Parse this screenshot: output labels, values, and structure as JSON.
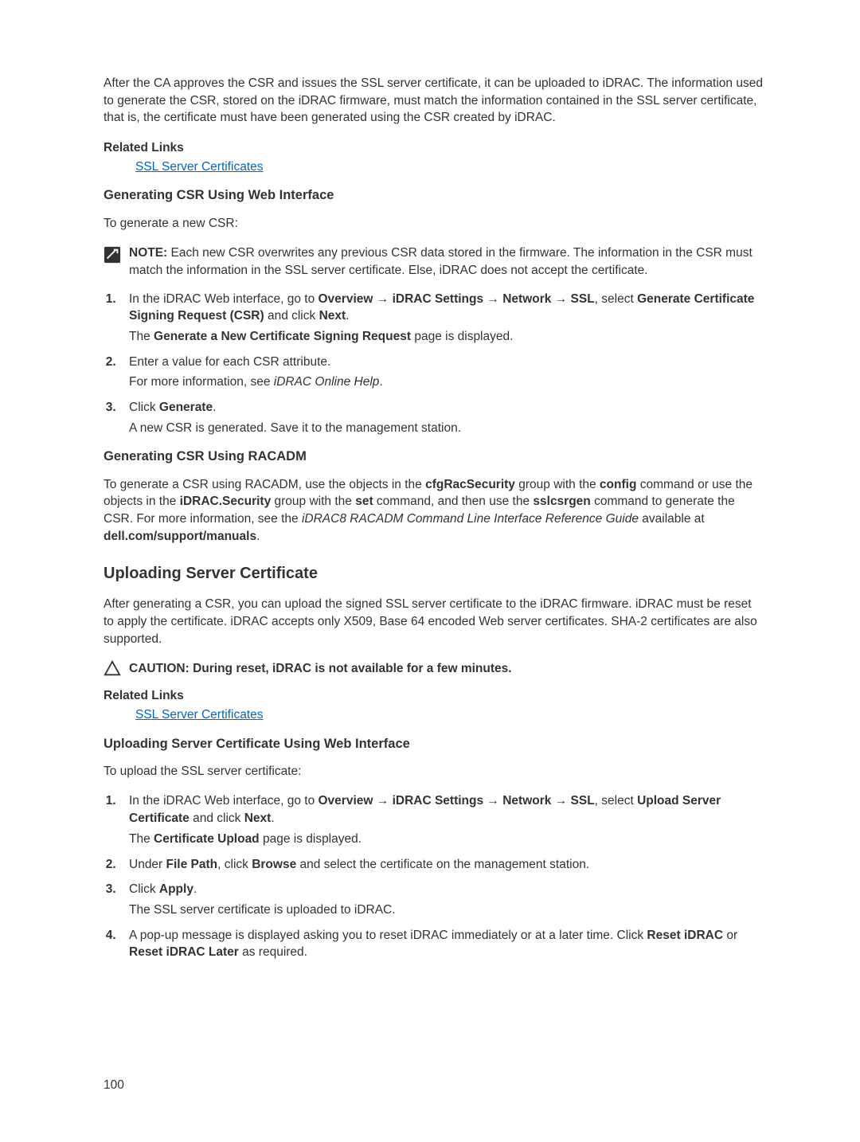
{
  "intro": "After the CA approves the CSR and issues the SSL server certificate, it can be uploaded to iDRAC. The information used to generate the CSR, stored on the iDRAC firmware, must match the information contained in the SSL server certificate, that is, the certificate must have been generated using the CSR created by iDRAC.",
  "related_links_label": "Related Links",
  "ssl_link": "SSL Server Certificates",
  "s1": {
    "heading": "Generating CSR Using Web Interface",
    "intro": "To generate a new CSR:",
    "note_bold": "NOTE: ",
    "note": "Each new CSR overwrites any previous CSR data stored in the firmware. The information in the CSR must match the information in the SSL server certificate. Else, iDRAC does not accept the certificate.",
    "step1_a": "In the iDRAC Web interface, go to ",
    "overview": "Overview",
    "arrow": " → ",
    "idrac_settings": "iDRAC Settings",
    "network": "Network",
    "ssl": "SSL",
    "step1_b": ", select ",
    "gen_csr": "Generate Certificate Signing Request (CSR)",
    "step1_c": " and click ",
    "next": "Next",
    "period": ".",
    "step1_sub_a": "The ",
    "gen_new_csr": "Generate a New Certificate Signing Request",
    "step1_sub_b": " page is displayed.",
    "step2": "Enter a value for each CSR attribute.",
    "step2_sub_a": "For more information, see ",
    "step2_sub_italic": "iDRAC Online Help",
    "step3_a": "Click ",
    "generate": "Generate",
    "step3_sub": "A new CSR is generated. Save it to the management station."
  },
  "s2": {
    "heading": "Generating CSR Using RACADM",
    "p_a": "To generate a CSR using RACADM, use the objects in the ",
    "cfg": "cfgRacSecurity",
    "p_b": " group with the ",
    "config": "config",
    "p_c": " command or use the objects in the ",
    "idrac_sec": "iDRAC.Security",
    "p_d": " group with the ",
    "set": "set",
    "p_e": " command, and then use the ",
    "sslcsrgen": "sslcsrgen",
    "p_f": " command to generate the CSR. For more information, see the ",
    "guide": "iDRAC8 RACADM Command Line Interface Reference Guide",
    "p_g": " available at ",
    "url": "dell.com/support/manuals",
    "period": "."
  },
  "s3": {
    "heading": "Uploading Server Certificate",
    "intro": "After generating a CSR, you can upload the signed SSL server certificate to the iDRAC firmware. iDRAC must be reset to apply the certificate. iDRAC accepts only X509, Base 64 encoded Web server certificates. SHA-2 certificates are also supported.",
    "caution": "CAUTION: During reset, iDRAC is not available for a few minutes."
  },
  "s4": {
    "heading": "Uploading Server Certificate Using Web Interface",
    "intro": "To upload the SSL server certificate:",
    "step1_a": "In the iDRAC Web interface, go to ",
    "overview": "Overview",
    "arrow": " → ",
    "idrac_settings": "iDRAC Settings",
    "network": "Network",
    "ssl": "SSL",
    "step1_b": ", select ",
    "upload_cert": "Upload Server Certificate",
    "step1_c": " and click ",
    "next": "Next",
    "period": ".",
    "step1_sub_a": "The ",
    "cert_upload": "Certificate Upload",
    "step1_sub_b": " page is displayed.",
    "step2_a": "Under ",
    "file_path": "File Path",
    "step2_b": ", click ",
    "browse": "Browse",
    "step2_c": " and select the certificate on the management station.",
    "step3_a": "Click ",
    "apply": "Apply",
    "step3_sub": "The SSL server certificate is uploaded to iDRAC.",
    "step4_a": "A pop-up message is displayed asking you to reset iDRAC immediately or at a later time. Click ",
    "reset_idrac": "Reset iDRAC",
    "step4_b": " or ",
    "reset_later": "Reset iDRAC Later",
    "step4_c": " as required."
  },
  "page_number": "100"
}
